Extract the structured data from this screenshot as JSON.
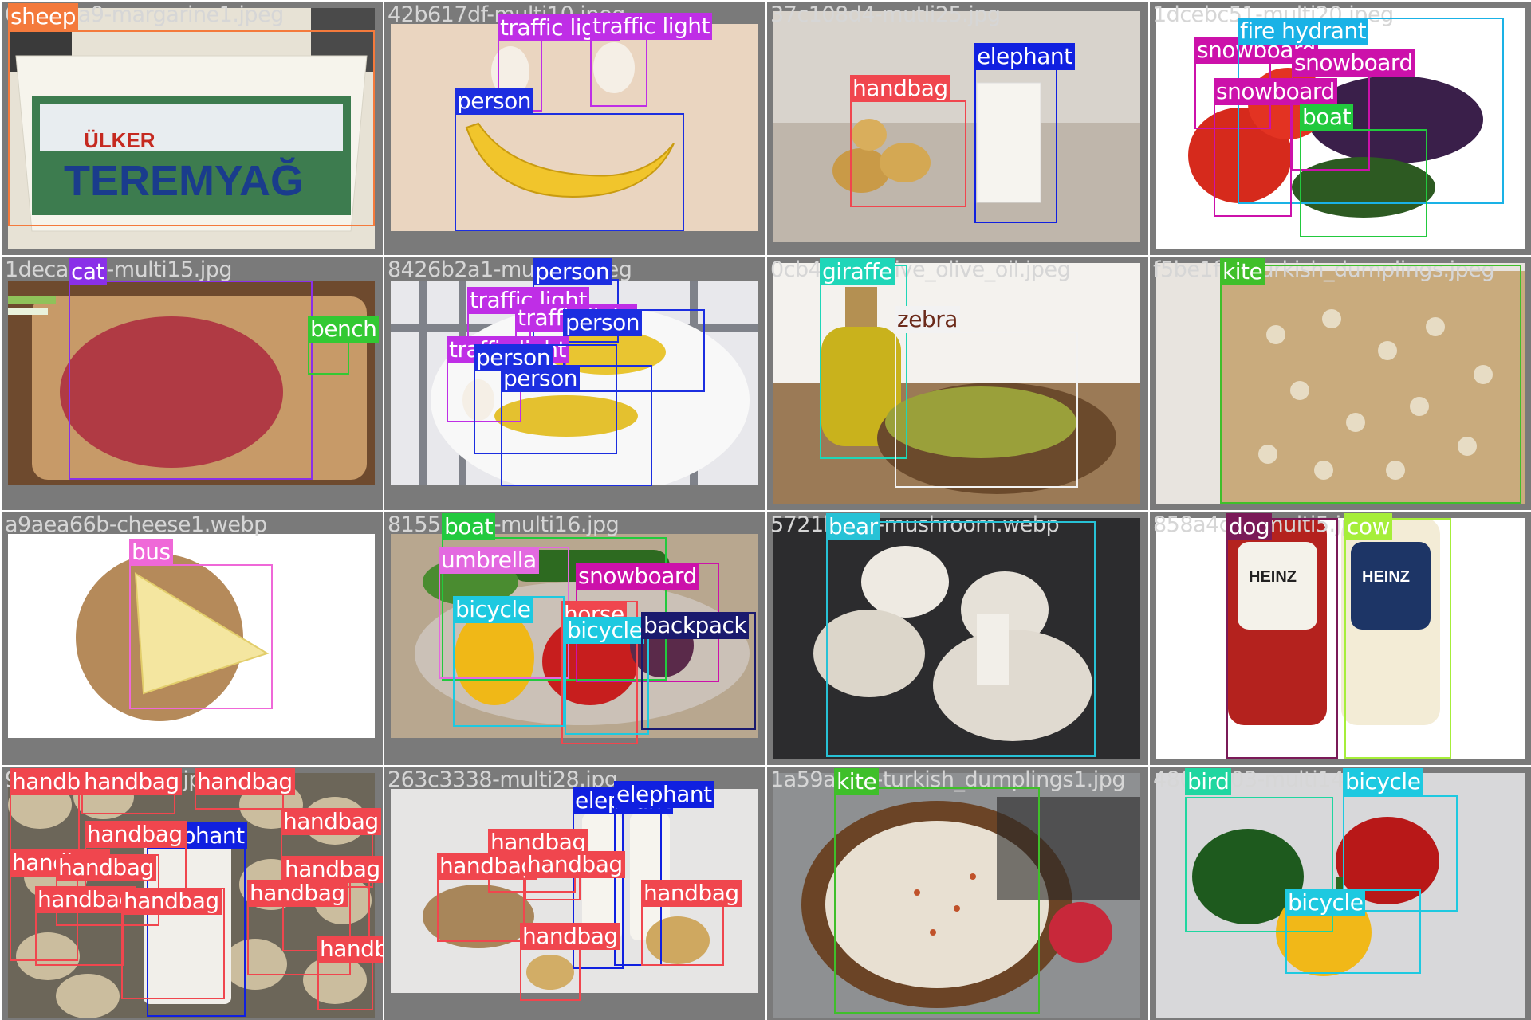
{
  "tiles": [
    {
      "filename": "0fd9a7a9-margarine1.jpeg",
      "photo": {
        "bg": "#e9e4d6"
      },
      "boxes": [
        {
          "label": "sheep",
          "color": "#f47a3c"
        }
      ]
    },
    {
      "filename": "42b617df-multi10.jpeg",
      "photo": {
        "bg": "#ead6c2"
      },
      "boxes": [
        {
          "label": "traffic light",
          "color": "#bf2ee6"
        },
        {
          "label": "traffic light",
          "color": "#bf2ee6"
        },
        {
          "label": "person",
          "color": "#1c2ee0"
        }
      ]
    },
    {
      "filename": "37c108d4-mutli25.jpg",
      "photo": {
        "bg": "#cfc9c2"
      },
      "boxes": [
        {
          "label": "handbag",
          "color": "#f0464e"
        },
        {
          "label": "elephant",
          "color": "#1020e0"
        }
      ]
    },
    {
      "filename": "1dcebc51-multi20.jpeg",
      "photo": {
        "bg": "#ffffff"
      },
      "boxes": [
        {
          "label": "snowboard",
          "color": "#cc11aa"
        },
        {
          "label": "fire hydrant",
          "color": "#1ab2e6"
        },
        {
          "label": "snowboard",
          "color": "#cc11aa"
        },
        {
          "label": "snowboard",
          "color": "#cc11aa"
        },
        {
          "label": "boat",
          "color": "#22c93e"
        }
      ]
    },
    {
      "filename": "1deca6c9-multi15.jpg",
      "photo": {
        "bg": "#b07e52"
      },
      "boxes": [
        {
          "label": "cat",
          "color": "#8a30e8"
        },
        {
          "label": "bench",
          "color": "#33c933"
        }
      ]
    },
    {
      "filename": "8426b2a1-multi19.jpeg",
      "photo": {
        "bg": "#d9d9de"
      },
      "boxes": [
        {
          "label": "person",
          "color": "#1c2ee0"
        },
        {
          "label": "traffic light",
          "color": "#bf2ee6"
        },
        {
          "label": "traffic light",
          "color": "#bf2ee6"
        },
        {
          "label": "person",
          "color": "#1c2ee0"
        },
        {
          "label": "traffic light",
          "color": "#bf2ee6"
        },
        {
          "label": "person",
          "color": "#1c2ee0"
        },
        {
          "label": "person",
          "color": "#1c2ee0"
        }
      ]
    },
    {
      "filename": "0cb4fb7e-olive_olive_oil.jpeg",
      "photo": {
        "bg": "#efece6"
      },
      "boxes": [
        {
          "label": "giraffe",
          "color": "#1fd6b8"
        },
        {
          "label": "zebra",
          "color": "#f2f2f2",
          "text_color": "#6b2a1a"
        }
      ]
    },
    {
      "filename": "f5be1fc5-turkish_dumplings.jpeg",
      "photo": {
        "bg": "#cbb79a"
      },
      "boxes": [
        {
          "label": "kite",
          "color": "#3fbf2a"
        }
      ]
    },
    {
      "filename": "a9aea66b-cheese1.webp",
      "photo": {
        "bg": "#ffffff"
      },
      "boxes": [
        {
          "label": "bus",
          "color": "#ef68d8"
        }
      ]
    },
    {
      "filename": "8155b3e1-multi16.jpg",
      "photo": {
        "bg": "#b7a68f"
      },
      "boxes": [
        {
          "label": "boat",
          "color": "#22c93e"
        },
        {
          "label": "umbrella",
          "color": "#e369e0"
        },
        {
          "label": "snowboard",
          "color": "#cc11aa"
        },
        {
          "label": "horse",
          "color": "#f0464e"
        },
        {
          "label": "bicycle",
          "color": "#1ec9e0"
        },
        {
          "label": "bicycle",
          "color": "#1ec9e0"
        },
        {
          "label": "backpack",
          "color": "#1a1a6e"
        }
      ]
    },
    {
      "filename": "5721b0d1-mushroom.webp",
      "photo": {
        "bg": "#2a2a2c"
      },
      "boxes": [
        {
          "label": "bear",
          "color": "#27c2d6"
        }
      ]
    },
    {
      "filename": "858a4cc2-multi5.jpg",
      "photo": {
        "bg": "#ffffff"
      },
      "boxes": [
        {
          "label": "dog",
          "color": "#7a1a58"
        },
        {
          "label": "cow",
          "color": "#a6ee3a"
        }
      ]
    },
    {
      "filename": "9c1f8e24-multi7.jpg",
      "photo": {
        "bg": "#6f6a5e"
      },
      "boxes": [
        {
          "label": "handbag",
          "color": "#f0464e"
        },
        {
          "label": "handbag",
          "color": "#f0464e"
        },
        {
          "label": "handbag",
          "color": "#f0464e"
        },
        {
          "label": "elephant",
          "color": "#1020e0"
        },
        {
          "label": "handbag",
          "color": "#f0464e"
        },
        {
          "label": "handbag",
          "color": "#f0464e"
        },
        {
          "label": "handbag",
          "color": "#f0464e"
        },
        {
          "label": "handbag",
          "color": "#f0464e"
        },
        {
          "label": "handbag",
          "color": "#f0464e"
        },
        {
          "label": "handbag",
          "color": "#f0464e"
        },
        {
          "label": "handbag",
          "color": "#f0464e"
        },
        {
          "label": "handbag",
          "color": "#f0464e"
        },
        {
          "label": "handbag",
          "color": "#f0464e"
        }
      ]
    },
    {
      "filename": "263c3338-multi28.jpg",
      "photo": {
        "bg": "#e4e3e2"
      },
      "boxes": [
        {
          "label": "elephant",
          "color": "#1020e0"
        },
        {
          "label": "elephant",
          "color": "#1020e0"
        },
        {
          "label": "handbag",
          "color": "#f0464e"
        },
        {
          "label": "handbag",
          "color": "#f0464e"
        },
        {
          "label": "handbag",
          "color": "#f0464e"
        },
        {
          "label": "handbag",
          "color": "#f0464e"
        },
        {
          "label": "handbag",
          "color": "#f0464e"
        }
      ]
    },
    {
      "filename": "1a59a8e4-turkish_dumplings1.jpg",
      "photo": {
        "bg": "#8d8f91"
      },
      "boxes": [
        {
          "label": "kite",
          "color": "#3fbf2a"
        }
      ]
    },
    {
      "filename": "480e7c03-multi14.jpg",
      "photo": {
        "bg": "#d7d7d9"
      },
      "boxes": [
        {
          "label": "bird",
          "color": "#1fd6a0"
        },
        {
          "label": "bicycle",
          "color": "#1ec9e0"
        },
        {
          "label": "bicycle",
          "color": "#1ec9e0"
        }
      ]
    }
  ]
}
